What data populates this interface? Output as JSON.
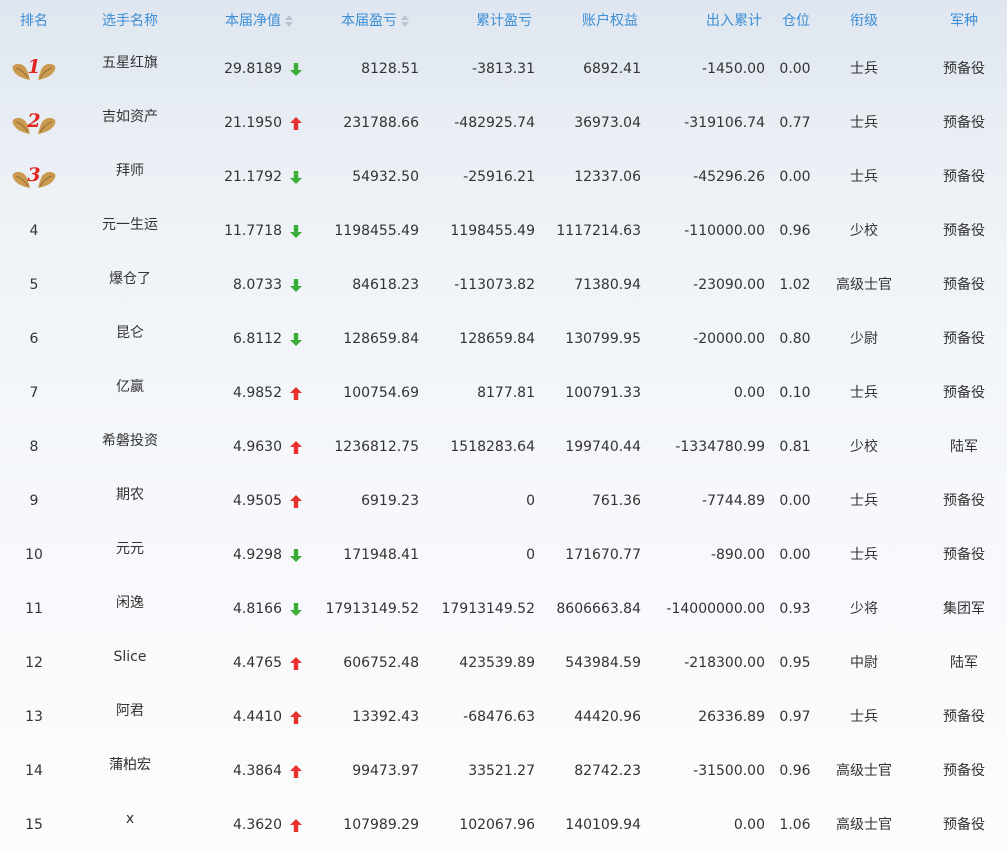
{
  "colors": {
    "header_text": "#3d8fd6",
    "up_arrow": "#e8312f",
    "down_arrow": "#3aae37",
    "medal_gold": "#c99a4f",
    "medal_number": "#e0261e"
  },
  "header": {
    "rank": "排名",
    "name": "选手名称",
    "nav": "本届净值",
    "pnl": "本届盈亏",
    "cum_pnl": "累计盈亏",
    "equity": "账户权益",
    "inout": "出入累计",
    "position": "仓位",
    "grade": "衔级",
    "branch": "军种"
  },
  "rows": [
    {
      "rank": "1",
      "medal": true,
      "name": "五星红旗",
      "nav": "29.8189",
      "trend": "down",
      "pnl": "8128.51",
      "cum_pnl": "-3813.31",
      "equity": "6892.41",
      "inout": "-1450.00",
      "position": "0.00",
      "grade": "士兵",
      "branch": "预备役"
    },
    {
      "rank": "2",
      "medal": true,
      "name": "吉如资产",
      "nav": "21.1950",
      "trend": "up",
      "pnl": "231788.66",
      "cum_pnl": "-482925.74",
      "equity": "36973.04",
      "inout": "-319106.74",
      "position": "0.77",
      "grade": "士兵",
      "branch": "预备役"
    },
    {
      "rank": "3",
      "medal": true,
      "name": "拜师",
      "nav": "21.1792",
      "trend": "down",
      "pnl": "54932.50",
      "cum_pnl": "-25916.21",
      "equity": "12337.06",
      "inout": "-45296.26",
      "position": "0.00",
      "grade": "士兵",
      "branch": "预备役"
    },
    {
      "rank": "4",
      "medal": false,
      "name": "元一生运",
      "nav": "11.7718",
      "trend": "down",
      "pnl": "1198455.49",
      "cum_pnl": "1198455.49",
      "equity": "1117214.63",
      "inout": "-110000.00",
      "position": "0.96",
      "grade": "少校",
      "branch": "预备役"
    },
    {
      "rank": "5",
      "medal": false,
      "name": "爆仓了",
      "nav": "8.0733",
      "trend": "down",
      "pnl": "84618.23",
      "cum_pnl": "-113073.82",
      "equity": "71380.94",
      "inout": "-23090.00",
      "position": "1.02",
      "grade": "高级士官",
      "branch": "预备役"
    },
    {
      "rank": "6",
      "medal": false,
      "name": "昆仑",
      "nav": "6.8112",
      "trend": "down",
      "pnl": "128659.84",
      "cum_pnl": "128659.84",
      "equity": "130799.95",
      "inout": "-20000.00",
      "position": "0.80",
      "grade": "少尉",
      "branch": "预备役"
    },
    {
      "rank": "7",
      "medal": false,
      "name": "亿赢",
      "nav": "4.9852",
      "trend": "up",
      "pnl": "100754.69",
      "cum_pnl": "8177.81",
      "equity": "100791.33",
      "inout": "0.00",
      "position": "0.10",
      "grade": "士兵",
      "branch": "预备役"
    },
    {
      "rank": "8",
      "medal": false,
      "name": "希磐投资",
      "nav": "4.9630",
      "trend": "up",
      "pnl": "1236812.75",
      "cum_pnl": "1518283.64",
      "equity": "199740.44",
      "inout": "-1334780.99",
      "position": "0.81",
      "grade": "少校",
      "branch": "陆军"
    },
    {
      "rank": "9",
      "medal": false,
      "name": "期农",
      "nav": "4.9505",
      "trend": "up",
      "pnl": "6919.23",
      "cum_pnl": "0",
      "equity": "761.36",
      "inout": "-7744.89",
      "position": "0.00",
      "grade": "士兵",
      "branch": "预备役"
    },
    {
      "rank": "10",
      "medal": false,
      "name": "元元",
      "nav": "4.9298",
      "trend": "down",
      "pnl": "171948.41",
      "cum_pnl": "0",
      "equity": "171670.77",
      "inout": "-890.00",
      "position": "0.00",
      "grade": "士兵",
      "branch": "预备役"
    },
    {
      "rank": "11",
      "medal": false,
      "name": "闲逸",
      "nav": "4.8166",
      "trend": "down",
      "pnl": "17913149.52",
      "cum_pnl": "17913149.52",
      "equity": "8606663.84",
      "inout": "-14000000.00",
      "position": "0.93",
      "grade": "少将",
      "branch": "集团军"
    },
    {
      "rank": "12",
      "medal": false,
      "name": "Slice",
      "nav": "4.4765",
      "trend": "up",
      "pnl": "606752.48",
      "cum_pnl": "423539.89",
      "equity": "543984.59",
      "inout": "-218300.00",
      "position": "0.95",
      "grade": "中尉",
      "branch": "陆军"
    },
    {
      "rank": "13",
      "medal": false,
      "name": "阿君",
      "nav": "4.4410",
      "trend": "up",
      "pnl": "13392.43",
      "cum_pnl": "-68476.63",
      "equity": "44420.96",
      "inout": "26336.89",
      "position": "0.97",
      "grade": "士兵",
      "branch": "预备役"
    },
    {
      "rank": "14",
      "medal": false,
      "name": "蒲柏宏",
      "nav": "4.3864",
      "trend": "up",
      "pnl": "99473.97",
      "cum_pnl": "33521.27",
      "equity": "82742.23",
      "inout": "-31500.00",
      "position": "0.96",
      "grade": "高级士官",
      "branch": "预备役"
    },
    {
      "rank": "15",
      "medal": false,
      "name": "x",
      "nav": "4.3620",
      "trend": "up",
      "pnl": "107989.29",
      "cum_pnl": "102067.96",
      "equity": "140109.94",
      "inout": "0.00",
      "position": "1.06",
      "grade": "高级士官",
      "branch": "预备役"
    }
  ]
}
